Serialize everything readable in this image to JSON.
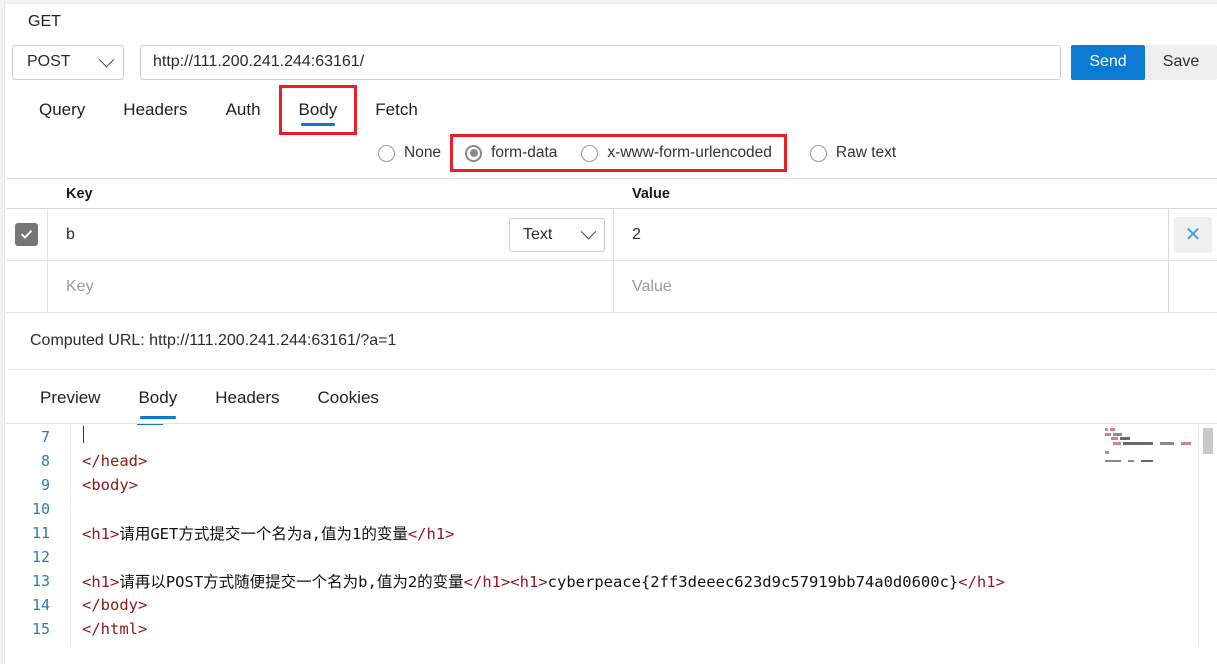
{
  "header": {
    "method_label": "GET"
  },
  "urlbar": {
    "method": "POST",
    "url_value": "http://111.200.241.244:63161/",
    "url_placeholder": "http://",
    "send_label": "Send",
    "save_label": "Save"
  },
  "request_tabs": [
    {
      "label": "Query",
      "active": false,
      "boxed": false
    },
    {
      "label": "Headers",
      "active": false,
      "boxed": false
    },
    {
      "label": "Auth",
      "active": false,
      "boxed": false
    },
    {
      "label": "Body",
      "active": true,
      "boxed": true
    },
    {
      "label": "Fetch",
      "active": false,
      "boxed": false
    }
  ],
  "body_types": [
    {
      "label": "None",
      "checked": false,
      "boxed": false
    },
    {
      "label": "form-data",
      "checked": true,
      "boxed": true
    },
    {
      "label": "x-www-form-urlencoded",
      "checked": false,
      "boxed": true
    },
    {
      "label": "Raw text",
      "checked": false,
      "boxed": false
    }
  ],
  "kv_table": {
    "headers": {
      "key": "Key",
      "value": "Value"
    },
    "rows": [
      {
        "checked": true,
        "key": "b",
        "key_placeholder": "Key",
        "type": "Text",
        "value": "2",
        "value_placeholder": "Value",
        "delete_label": "✕",
        "is_blank": false
      },
      {
        "checked": false,
        "key": "",
        "key_placeholder": "Key",
        "type": "",
        "value": "",
        "value_placeholder": "Value",
        "delete_label": "",
        "is_blank": true
      }
    ]
  },
  "computed": {
    "label": "Computed URL: http://111.200.241.244:63161/?a=1"
  },
  "response_tabs": [
    {
      "label": "Preview",
      "active": false
    },
    {
      "label": "Body",
      "active": true
    },
    {
      "label": "Headers",
      "active": false
    },
    {
      "label": "Cookies",
      "active": false
    }
  ],
  "editor": {
    "lines": [
      {
        "num": "7",
        "segments": []
      },
      {
        "num": "8",
        "segments": [
          {
            "t": "tag",
            "s": "</head>"
          }
        ]
      },
      {
        "num": "9",
        "segments": [
          {
            "t": "tag",
            "s": "<body>"
          }
        ]
      },
      {
        "num": "10",
        "segments": []
      },
      {
        "num": "11",
        "segments": [
          {
            "t": "tag",
            "s": "<h1>"
          },
          {
            "t": "txt",
            "s": "请用GET方式提交一个名为a,值为1的变量"
          },
          {
            "t": "tag",
            "s": "</h1>"
          }
        ]
      },
      {
        "num": "12",
        "segments": []
      },
      {
        "num": "13",
        "segments": [
          {
            "t": "tag",
            "s": "<h1>"
          },
          {
            "t": "txt",
            "s": "请再以POST方式随便提交一个名为b,值为2的变量"
          },
          {
            "t": "tag",
            "s": "</h1>"
          },
          {
            "t": "tag",
            "s": "<h1>"
          },
          {
            "t": "txt",
            "s": "cyberpeace{2ff3deeec623d9c57919bb74a0d0600c}"
          },
          {
            "t": "tag",
            "s": "</h1>"
          }
        ]
      },
      {
        "num": "14",
        "segments": [
          {
            "t": "tag",
            "s": "</body>"
          }
        ]
      },
      {
        "num": "15",
        "segments": [
          {
            "t": "tag",
            "s": "</html>"
          }
        ]
      }
    ]
  },
  "colors": {
    "accent": "#0b7ad1",
    "highlight_box": "#ee1c25",
    "tag": "#8b1a1a",
    "line_number": "#2b7fb5",
    "checkbox": "#767676",
    "delete_icon": "#46a0e8"
  }
}
